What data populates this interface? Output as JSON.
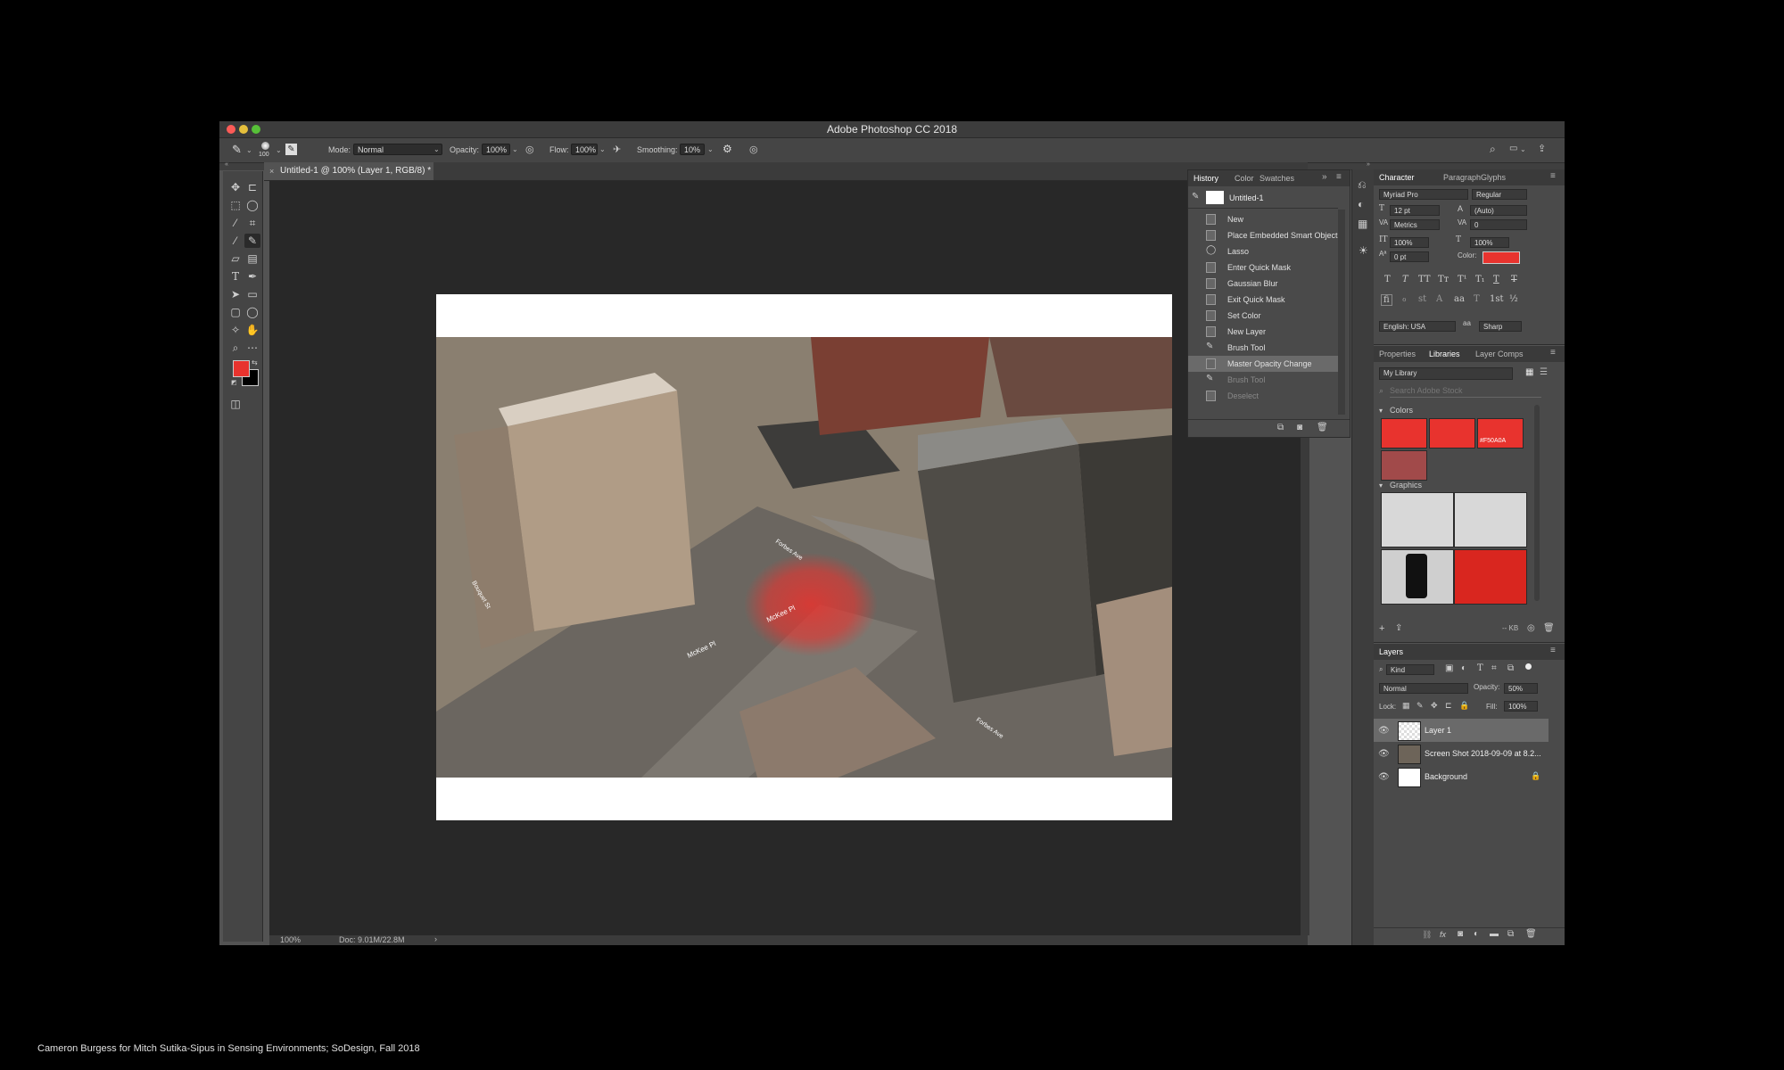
{
  "window": {
    "title": "Adobe Photoshop CC 2018"
  },
  "options_bar": {
    "brush_size": "100",
    "mode_label": "Mode:",
    "mode_value": "Normal",
    "opacity_label": "Opacity:",
    "opacity_value": "100%",
    "flow_label": "Flow:",
    "flow_value": "100%",
    "smoothing_label": "Smoothing:",
    "smoothing_value": "10%"
  },
  "document": {
    "tab_title": "Untitled-1 @ 100% (Layer 1, RGB/8) *",
    "street_labels": [
      "McKee Pl",
      "McKee Pl",
      "Forbes Ave",
      "Forbes Ave",
      "Bouquet St"
    ]
  },
  "status": {
    "zoom": "100%",
    "doc_size": "Doc: 9.01M/22.8M"
  },
  "colors": {
    "foreground": "#E8332E",
    "background": "#000000",
    "accent": "#F50A0A"
  },
  "history_panel": {
    "tabs": [
      "History",
      "Color",
      "Swatches"
    ],
    "snapshot": "Untitled-1",
    "items": [
      {
        "label": "New",
        "icon": "document-icon",
        "state": "normal"
      },
      {
        "label": "Place Embedded Smart Object",
        "icon": "document-icon",
        "state": "normal"
      },
      {
        "label": "Lasso",
        "icon": "lasso-icon",
        "state": "normal"
      },
      {
        "label": "Enter Quick Mask",
        "icon": "document-icon",
        "state": "normal"
      },
      {
        "label": "Gaussian Blur",
        "icon": "document-icon",
        "state": "normal"
      },
      {
        "label": "Exit Quick Mask",
        "icon": "document-icon",
        "state": "normal"
      },
      {
        "label": "Set Color",
        "icon": "document-icon",
        "state": "normal"
      },
      {
        "label": "New Layer",
        "icon": "document-icon",
        "state": "normal"
      },
      {
        "label": "Brush Tool",
        "icon": "brush-icon",
        "state": "normal"
      },
      {
        "label": "Master Opacity Change",
        "icon": "document-icon",
        "state": "selected"
      },
      {
        "label": "Brush Tool",
        "icon": "brush-icon",
        "state": "dimmed"
      },
      {
        "label": "Deselect",
        "icon": "document-icon",
        "state": "dimmed"
      }
    ]
  },
  "character_panel": {
    "tabs": [
      "Character",
      "Paragraph",
      "Glyphs"
    ],
    "font_family": "Myriad Pro",
    "font_style": "Regular",
    "font_size": "12 pt",
    "leading": "(Auto)",
    "kerning": "Metrics",
    "tracking": "0",
    "vertical_scale": "100%",
    "horizontal_scale": "100%",
    "baseline_shift": "0 pt",
    "color_label": "Color:",
    "language": "English: USA",
    "aa_label": "aa",
    "antialias": "Sharp",
    "style_buttons": [
      "T",
      "T",
      "TT",
      "Tт",
      "T¹",
      "T₁",
      "T",
      "T"
    ],
    "opentype_buttons": [
      "fi",
      "ℴ",
      "st",
      "A",
      "aa",
      "T",
      "1st",
      "½"
    ]
  },
  "libraries_panel": {
    "tabs": [
      "Properties",
      "Libraries",
      "Layer Comps"
    ],
    "library": "My Library",
    "search_placeholder": "Search Adobe Stock",
    "colors_heading": "Colors",
    "swatch_hex": "#F50A0A",
    "graphics_heading": "Graphics",
    "size_text": "-- KB"
  },
  "layers_panel": {
    "title": "Layers",
    "filter_kind": "Kind",
    "blend_mode": "Normal",
    "opacity_label": "Opacity:",
    "opacity_value": "50%",
    "lock_label": "Lock:",
    "fill_label": "Fill:",
    "fill_value": "100%",
    "layers": [
      {
        "name": "Layer 1",
        "selected": true
      },
      {
        "name": "Screen Shot 2018-09-09 at 8.2...",
        "selected": false
      },
      {
        "name": "Background",
        "selected": false,
        "locked": true
      }
    ]
  },
  "caption": "Cameron Burgess for Mitch Sutika-Sipus in Sensing Environments; SoDesign, Fall 2018"
}
